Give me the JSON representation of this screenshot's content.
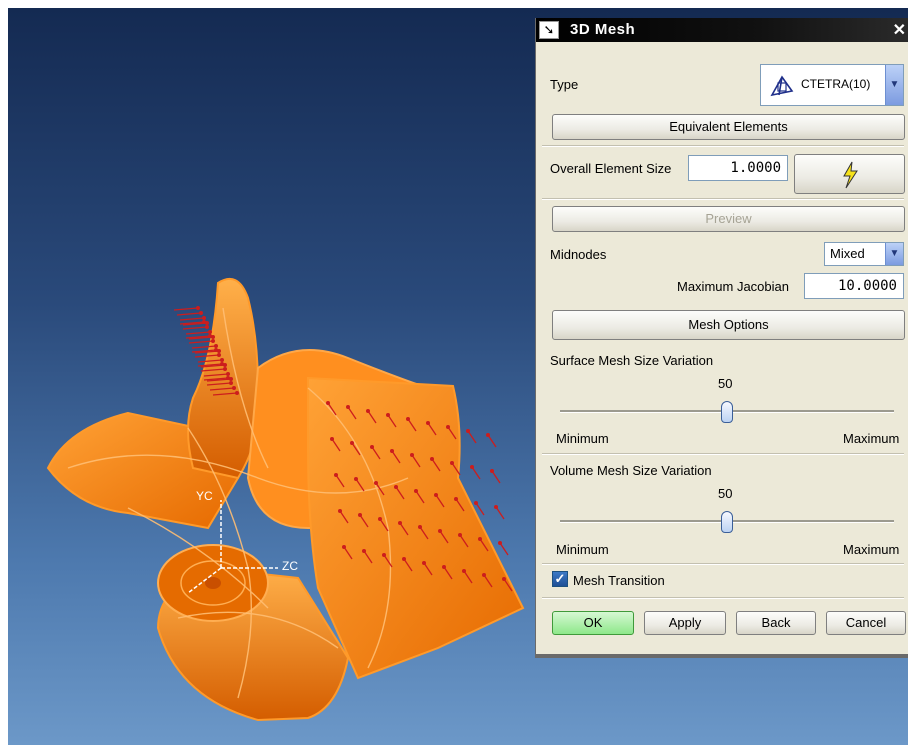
{
  "viewport": {
    "axis_labels": [
      "YC",
      "ZC"
    ],
    "part_color": "#ff8a1a",
    "background_top": "#142a52",
    "background_bottom": "#6c98c8",
    "marker_color": "#cc1d1d"
  },
  "dialog": {
    "title": "3D Mesh",
    "pin_icon": "pin-icon",
    "close_label": "✕",
    "type_label": "Type",
    "type_value": "CTETRA(10)",
    "equivalent_elements_label": "Equivalent Elements",
    "overall_element_size_label": "Overall Element Size",
    "overall_element_size_value": "1.0000",
    "auto_size_icon": "lightning-icon",
    "preview_label": "Preview",
    "midnodes_label": "Midnodes",
    "midnodes_value": "Mixed",
    "max_jacobian_label": "Maximum Jacobian",
    "max_jacobian_value": "10.0000",
    "mesh_options_label": "Mesh Options",
    "surface_variation": {
      "label": "Surface Mesh Size Variation",
      "value": "50",
      "min_label": "Minimum",
      "max_label": "Maximum",
      "level": 0.5
    },
    "volume_variation": {
      "label": "Volume Mesh Size Variation",
      "value": "50",
      "min_label": "Minimum",
      "max_label": "Maximum",
      "level": 0.5
    },
    "mesh_transition_label": "Mesh Transition",
    "mesh_transition_checked": true,
    "buttons": {
      "ok": "OK",
      "apply": "Apply",
      "back": "Back",
      "cancel": "Cancel"
    },
    "ok_color": "#8ee88a"
  }
}
